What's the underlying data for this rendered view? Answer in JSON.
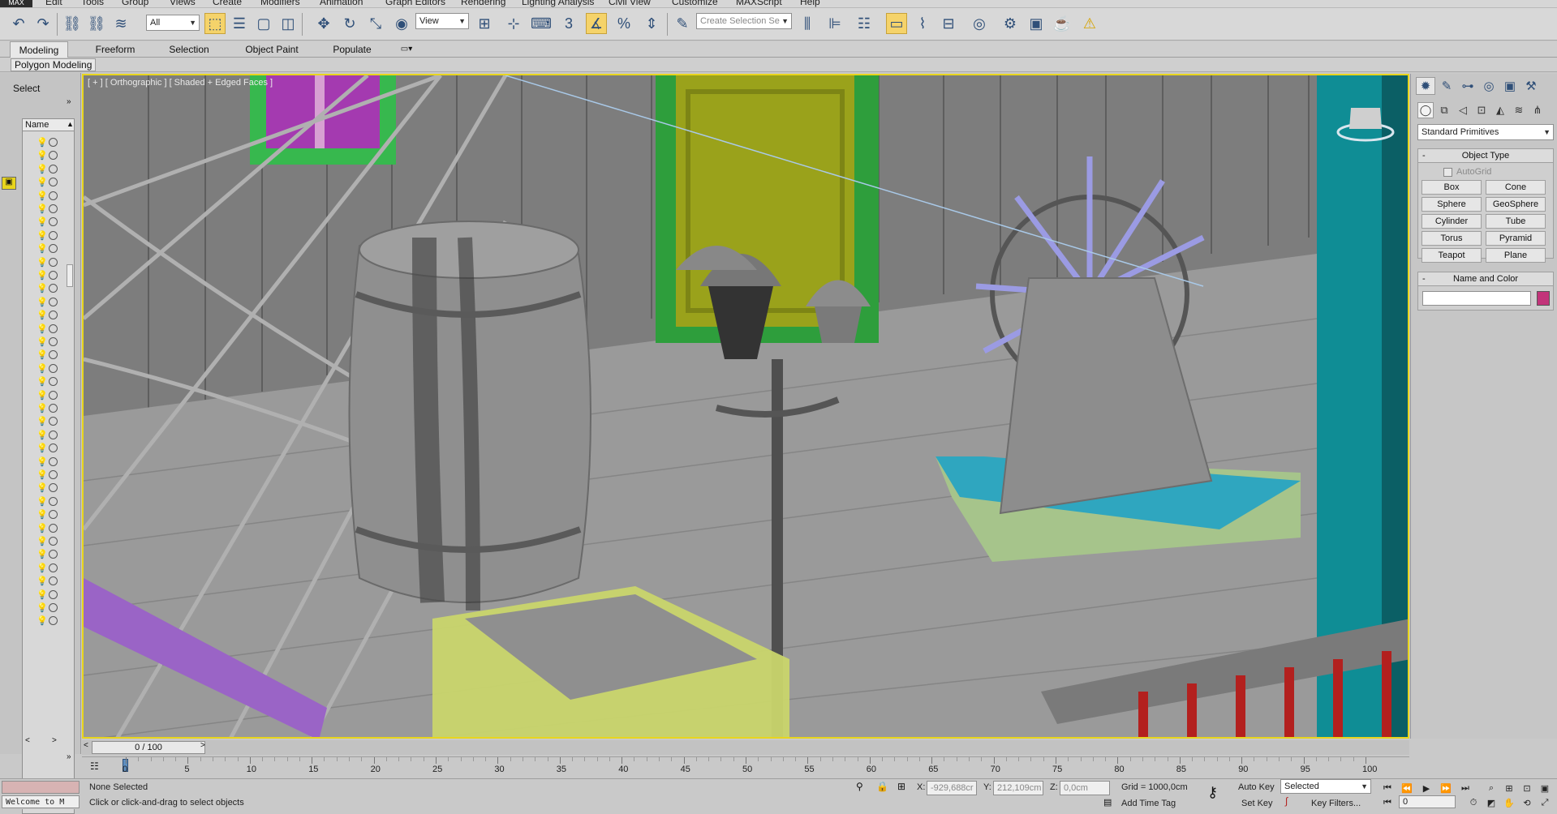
{
  "menubar": {
    "logo": "MAX",
    "items": [
      "Edit",
      "Tools",
      "Group",
      "Views",
      "Create",
      "Modifiers",
      "Animation",
      "Graph Editors",
      "Rendering",
      "Lighting Analysis",
      "Civil View",
      "Customize",
      "MAXScript",
      "Help"
    ]
  },
  "toolbar": {
    "filter_select": "All",
    "refcoord_select": "View",
    "selection_set_placeholder": "Create Selection Se",
    "snap_label": "3"
  },
  "ribbon": {
    "tabs": [
      "Modeling",
      "Freeform",
      "Selection",
      "Object Paint",
      "Populate"
    ],
    "active_tab": "Modeling",
    "panel_label": "Polygon Modeling"
  },
  "scene_explorer": {
    "select_label": "Select",
    "column_header": "Name",
    "row_count": 37
  },
  "viewport": {
    "label": "[ + ] [ Orthographic ] [ Shaded + Edged Faces ]",
    "border_color": "#e8d51d"
  },
  "command_panel": {
    "category_select": "Standard Primitives",
    "object_type_title": "Object Type",
    "autogrid_label": "AutoGrid",
    "buttons": [
      "Box",
      "Cone",
      "Sphere",
      "GeoSphere",
      "Cylinder",
      "Tube",
      "Torus",
      "Pyramid",
      "Teapot",
      "Plane"
    ],
    "name_color_title": "Name and Color",
    "name_value": "",
    "object_color": "#c2347a"
  },
  "timeline": {
    "frame_display": "0 / 100",
    "ticks": [
      "0",
      "5",
      "10",
      "15",
      "20",
      "25",
      "30",
      "35",
      "40",
      "45",
      "50",
      "55",
      "60",
      "65",
      "70",
      "75",
      "80",
      "85",
      "90",
      "95",
      "100"
    ]
  },
  "statusbar": {
    "maxscript_listener": "Welcome to M",
    "selection_status": "None Selected",
    "prompt": "Click or click-and-drag to select objects",
    "x_label": "X:",
    "x_value": "-929,688cr",
    "y_label": "Y:",
    "y_value": "212,109cm",
    "z_label": "Z:",
    "z_value": "0,0cm",
    "grid": "Grid = 1000,0cm",
    "add_time_tag": "Add Time Tag",
    "auto_key": "Auto Key",
    "set_key": "Set Key",
    "key_mode_select": "Selected",
    "key_filters": "Key Filters...",
    "current_frame": "0"
  }
}
